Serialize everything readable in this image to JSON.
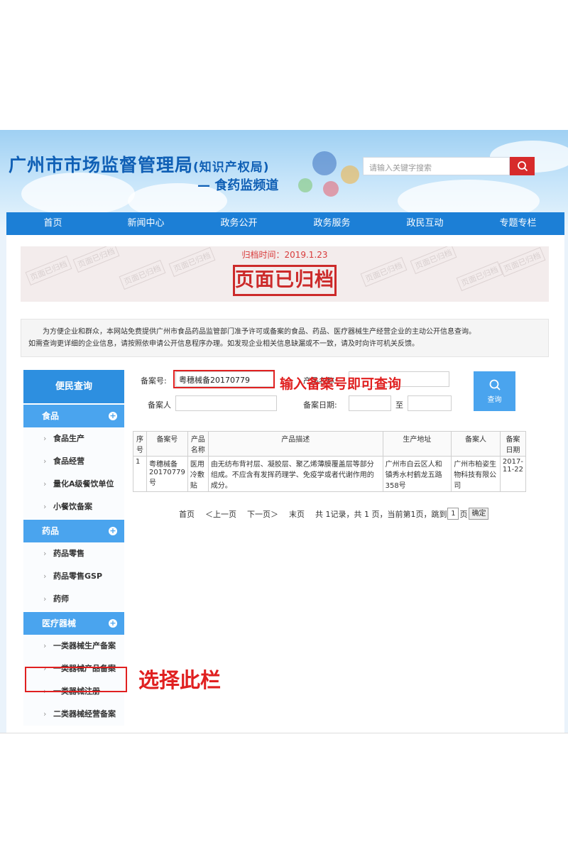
{
  "header": {
    "title": "广州市市场监督管理局",
    "title_suffix": "(知识产权局)",
    "subtitle": "— 食药监频道",
    "search_placeholder": "请输入关键字搜索"
  },
  "nav": {
    "items": [
      "首页",
      "新闻中心",
      "政务公开",
      "政务服务",
      "政民互动",
      "专题专栏"
    ]
  },
  "banner": {
    "archive_time": "归档时间：2019.1.23",
    "stamp": "页面已归档",
    "watermark": "页面已归档"
  },
  "notice": {
    "line1": "为方便企业和群众，本网站免费提供广州市食品药品监管部门准予许可或备案的食品、药品、医疗器械生产经营企业的主动公开信息查询。",
    "line2": "如需查询更详细的企业信息，请按照依申请公开信息程序办理。如发现企业相关信息缺漏或不一致，请及时向许可机关反馈。"
  },
  "sidebar": {
    "header": "便民查询",
    "sections": [
      {
        "label": "食品",
        "items": [
          "食品生产",
          "食品经营",
          "量化A级餐饮单位",
          "小餐饮备案"
        ]
      },
      {
        "label": "药品",
        "items": [
          "药品零售",
          "药品零售GSP",
          "药师"
        ]
      },
      {
        "label": "医疗器械",
        "items": [
          "一类器械生产备案",
          "一类器械产品备案",
          "一类器械注册",
          "二类器械经营备案"
        ]
      }
    ]
  },
  "form": {
    "record_no_label": "备案号:",
    "record_no_value": "粤穗械备20170779",
    "product_name_label": "产品名称:",
    "filer_label": "备案人",
    "date_label": "备案日期:",
    "date_to": "至",
    "query_label": "查询"
  },
  "table": {
    "headers": [
      "序号",
      "备案号",
      "产品名称",
      "产品描述",
      "生产地址",
      "备案人",
      "备案日期"
    ],
    "rows": [
      [
        "1",
        "粤穗械备20170779号",
        "医用冷敷贴",
        "由无纺布背衬层、凝胶层、聚乙烯薄膜覆盖层等部分组成。不应含有发挥药理学、免疫学或者代谢作用的成分。",
        "广州市白云区人和镇秀水村鹤龙五路358号",
        "广州市柏姿生物科技有限公司",
        "2017-11-22"
      ]
    ]
  },
  "pager": {
    "first": "首页",
    "prev": "＜上一页",
    "next": "下一页＞",
    "last": "末页",
    "summary": "共 1记录，共 1 页，当前第1页，跳到",
    "page_value": "1",
    "page_unit": "页",
    "confirm": "确定"
  },
  "annotations": {
    "query_hint": "输入备案号即可查询",
    "select_hint": "选择此栏"
  },
  "colors": {
    "nav_blue": "#1c7fd6",
    "side_blue": "#4aa4ee",
    "search_red": "#d72b2b",
    "annotation_red": "#e02020"
  }
}
